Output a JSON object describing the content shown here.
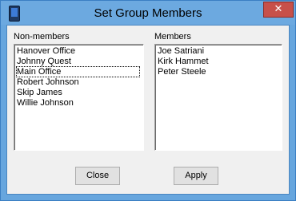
{
  "window": {
    "title": "Set Group Members"
  },
  "non_members": {
    "label": "Non-members",
    "items": [
      "Hanover Office",
      "Johnny Quest",
      "Main Office",
      "Robert Johnson",
      "Skip James",
      "Willie Johnson"
    ],
    "focused_index": 2
  },
  "members": {
    "label": "Members",
    "items": [
      "Joe Satriani",
      "Kirk Hammet",
      "Peter Steele"
    ]
  },
  "buttons": {
    "close_label": "Close",
    "apply_label": "Apply"
  },
  "colors": {
    "titlebar": "#6ca9e0",
    "close_button": "#c7504a",
    "dialog_background": "#f0f0f0"
  },
  "icons": {
    "app": "phone-device-icon",
    "close": "close-icon"
  }
}
